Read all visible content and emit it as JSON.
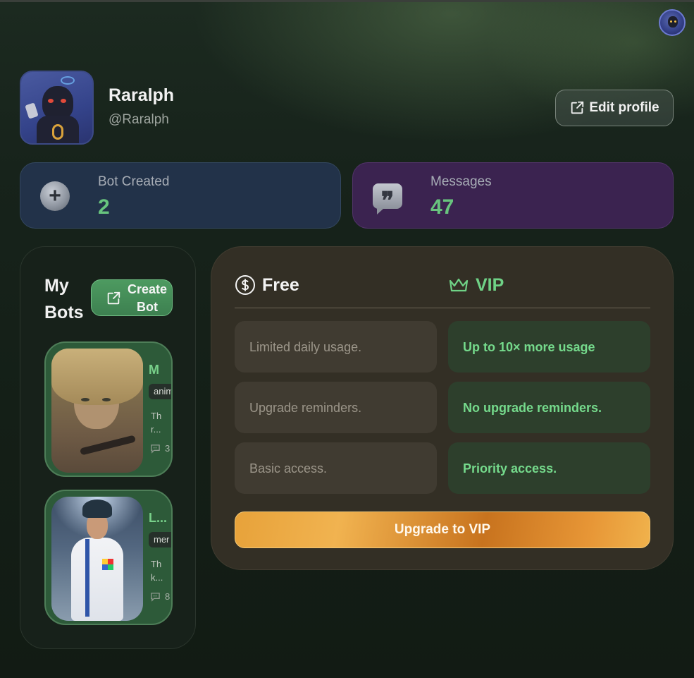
{
  "header": {
    "user_name": "Raralph",
    "user_handle": "@Raralph",
    "edit_profile_label": "Edit profile"
  },
  "stats": {
    "bot_created_label": "Bot Created",
    "bot_created_value": "2",
    "messages_label": "Messages",
    "messages_value": "47"
  },
  "my_bots": {
    "title": "My Bots",
    "create_label_line1": "Create",
    "create_label_line2": "Bot",
    "bots": [
      {
        "name": "M",
        "tag": "anim",
        "desc": "Th\nr...",
        "count": "3"
      },
      {
        "name": "L...",
        "tag": "mer",
        "desc": "Th\nk...",
        "count": "8"
      }
    ]
  },
  "plans": {
    "free_label": "Free",
    "vip_label": "VIP",
    "free_features": [
      "Limited daily usage.",
      "Upgrade reminders.",
      "Basic access."
    ],
    "vip_features": [
      "Up to 10× more usage",
      "No upgrade reminders.",
      "Priority access."
    ],
    "upgrade_label": "Upgrade to VIP"
  },
  "icons": {
    "edit": "edit-square-icon",
    "plus": "plus-circle-icon",
    "quote": "quote-bubble-icon",
    "dollar": "dollar-circle-icon",
    "crown": "crown-icon",
    "chat": "chat-bubble-icon"
  },
  "colors": {
    "accent_green": "#68c47e",
    "vip_green": "#75da8c",
    "bot_card_bg": "#223249",
    "messages_card_bg": "#3b2350",
    "upgrade_gold": "#e7a23a"
  }
}
